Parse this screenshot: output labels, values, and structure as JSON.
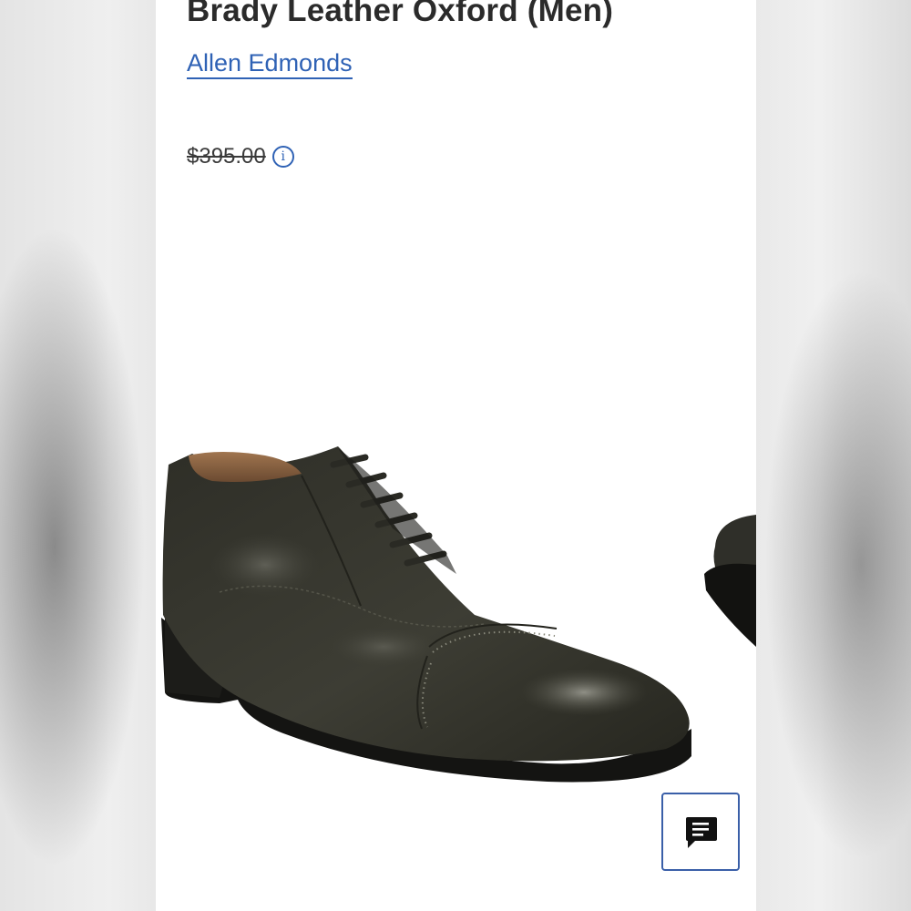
{
  "product": {
    "title": "Brady Leather Oxford (Men)",
    "brand": "Allen Edmonds",
    "original_price": "$395.00"
  },
  "icons": {
    "price_info": "info-icon",
    "chat": "chat-icon"
  },
  "colors": {
    "link": "#2f62b5",
    "title": "#2b2b2b",
    "shoe_leather": "#3a3a32"
  }
}
